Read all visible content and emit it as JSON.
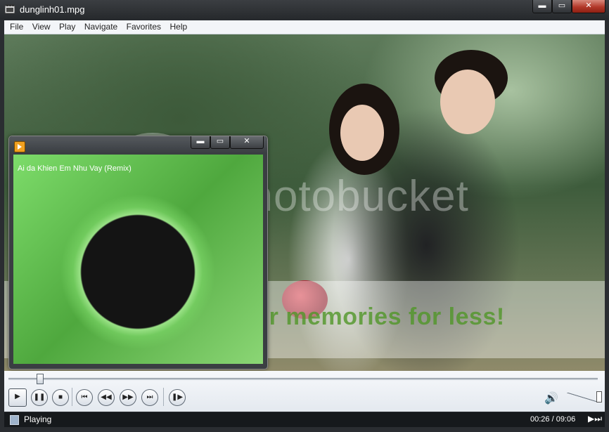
{
  "window": {
    "title": "dunglinh01.mpg",
    "controls": {
      "minimize": "▬",
      "maximize": "▭",
      "close": "✕"
    }
  },
  "menu": {
    "items": [
      "File",
      "View",
      "Play",
      "Navigate",
      "Favorites",
      "Help"
    ]
  },
  "watermark": {
    "logo_text": "photobucket",
    "banner_text": "Protect more of your memories for less!"
  },
  "subwindow": {
    "track_title": "Ai da Khien Em Nhu Vay (Remix)",
    "controls": {
      "minimize": "▬",
      "maximize": "▭",
      "close": "✕"
    }
  },
  "playback": {
    "buttons": {
      "play": "▶",
      "pause": "❚❚",
      "stop": "■",
      "prev": "⏮",
      "rewind": "◀◀",
      "forward": "▶▶",
      "next": "⏭",
      "frame_step": "❚▶"
    },
    "position_fraction": 0.048,
    "volume_icon": "speaker-icon"
  },
  "status": {
    "state": "Playing",
    "time": "00:26 / 09:06",
    "end_icon": "▶⏭"
  },
  "colors": {
    "accent_green": "#2e9a2e",
    "banner_text": "#50962a"
  }
}
